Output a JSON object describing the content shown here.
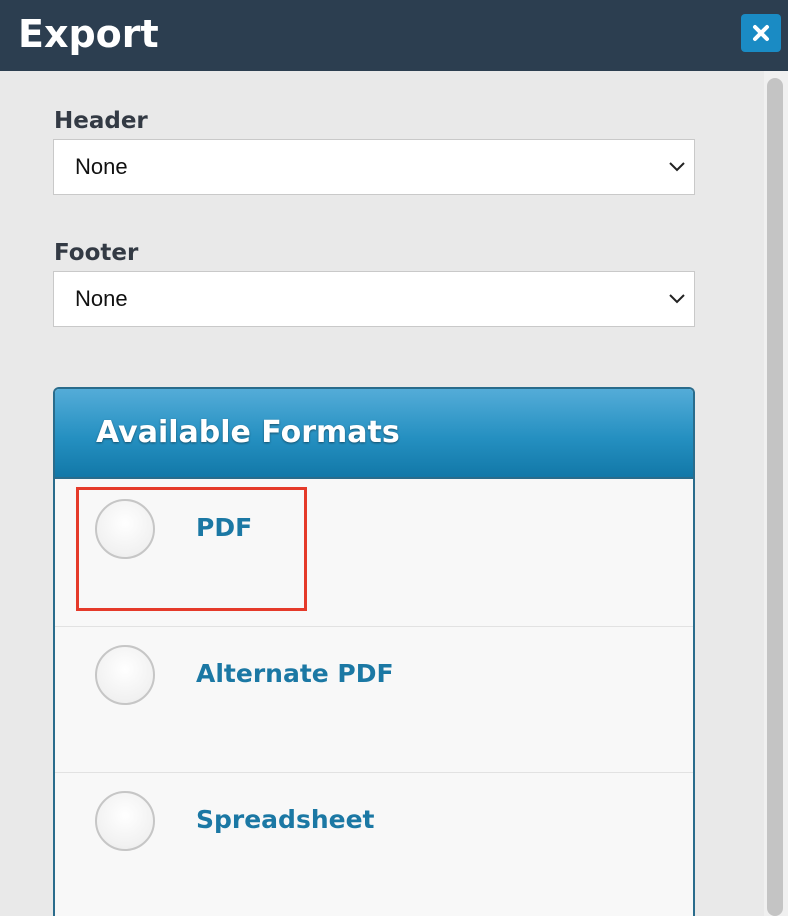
{
  "dialog": {
    "title": "Export",
    "close_icon": "close-icon"
  },
  "header_field": {
    "label": "Header",
    "value": "None"
  },
  "footer_field": {
    "label": "Footer",
    "value": "None"
  },
  "formats": {
    "title": "Available Formats",
    "options": [
      {
        "label": "PDF",
        "selected": false
      },
      {
        "label": "Alternate PDF",
        "selected": false
      },
      {
        "label": "Spreadsheet",
        "selected": false
      }
    ]
  },
  "colors": {
    "titlebar": "#2c3e50",
    "accent": "#1b78a4",
    "close_button": "#1a8bc4",
    "highlight": "#e53a2a"
  }
}
